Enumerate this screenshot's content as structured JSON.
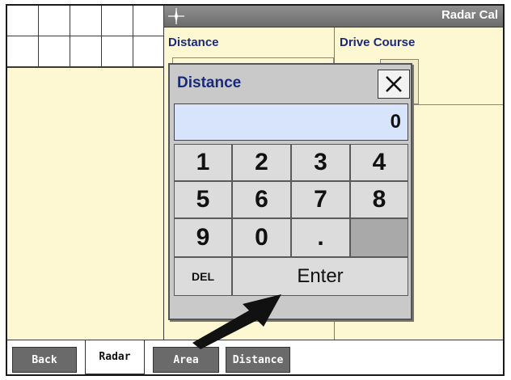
{
  "window": {
    "title": "Radar Cal",
    "compass_icon": "compass-icon"
  },
  "main": {
    "distance_label": "Distance",
    "drive_course_label": "Drive Course"
  },
  "dialog": {
    "title": "Distance",
    "close_icon": "close-icon",
    "display_value": "0",
    "keys": {
      "k1": "1",
      "k2": "2",
      "k3": "3",
      "k4": "4",
      "k5": "5",
      "k6": "6",
      "k7": "7",
      "k8": "8",
      "k9": "9",
      "k0": "0",
      "dot": ".",
      "del": "DEL",
      "enter": "Enter"
    }
  },
  "tabs": {
    "back": "Back",
    "radar": "Radar",
    "area": "Area",
    "distance": "Distance"
  },
  "colors": {
    "accent_text": "#1a2a7a",
    "pane_background": "#fdf8d2",
    "display_background": "#d8e4fb",
    "tab_dark": "#6a6a6a"
  }
}
